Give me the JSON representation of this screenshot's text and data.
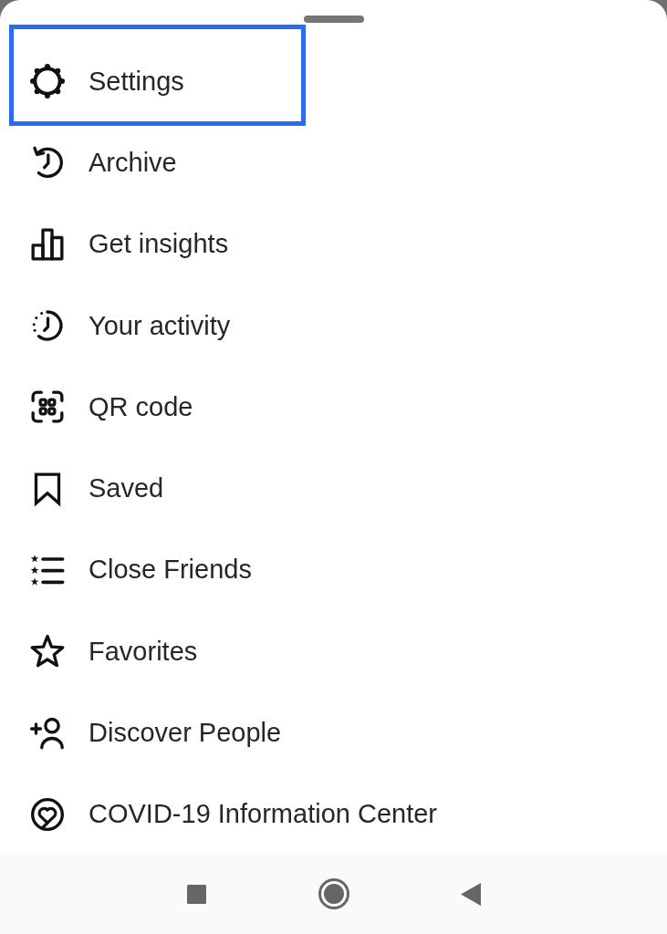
{
  "menu_items": [
    {
      "label": "Settings",
      "highlighted": true
    },
    {
      "label": "Archive",
      "highlighted": false
    },
    {
      "label": "Get insights",
      "highlighted": false
    },
    {
      "label": "Your activity",
      "highlighted": false
    },
    {
      "label": "QR code",
      "highlighted": false
    },
    {
      "label": "Saved",
      "highlighted": false
    },
    {
      "label": "Close Friends",
      "highlighted": false
    },
    {
      "label": "Favorites",
      "highlighted": false
    },
    {
      "label": "Discover People",
      "highlighted": false
    },
    {
      "label": "COVID-19 Information Center",
      "highlighted": false
    }
  ]
}
